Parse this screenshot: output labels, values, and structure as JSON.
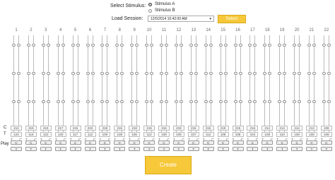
{
  "select_stimulus_label": "Select Stimulus:",
  "stimulus_options": [
    {
      "label": "Stimulus A",
      "selected": true
    },
    {
      "label": "Stimulus B",
      "selected": false
    }
  ],
  "load_session_label": "Load Session:",
  "session_value": "12/5/2014 10:42:00 AM",
  "select_button": "Select",
  "row_labels": {
    "c": "C",
    "t": "T",
    "play": "Play"
  },
  "track_letters": {
    "t": "T",
    "c": "C"
  },
  "play_letters": {
    "c": "C",
    "t": "T"
  },
  "columns": [
    {
      "num": "1",
      "c": "212",
      "t": "124"
    },
    {
      "num": "2",
      "c": "215",
      "t": "116"
    },
    {
      "num": "3",
      "c": "215",
      "t": "122"
    },
    {
      "num": "4",
      "c": "217",
      "t": "120"
    },
    {
      "num": "5",
      "c": "215",
      "t": "117"
    },
    {
      "num": "6",
      "c": "223",
      "t": "112"
    },
    {
      "num": "7",
      "c": "218",
      "t": "109"
    },
    {
      "num": "8",
      "c": "215",
      "t": "108"
    },
    {
      "num": "9",
      "c": "218",
      "t": "106"
    },
    {
      "num": "10",
      "c": "215",
      "t": "112"
    },
    {
      "num": "11",
      "c": "216",
      "t": "108"
    },
    {
      "num": "12",
      "c": "218",
      "t": "109"
    },
    {
      "num": "13",
      "c": "216",
      "t": "107"
    },
    {
      "num": "14",
      "c": "215",
      "t": "112"
    },
    {
      "num": "15",
      "c": "219",
      "t": "108"
    },
    {
      "num": "16",
      "c": "215",
      "t": "108"
    },
    {
      "num": "17",
      "c": "216",
      "t": "104"
    },
    {
      "num": "18",
      "c": "214",
      "t": "108"
    },
    {
      "num": "19",
      "c": "214",
      "t": "110"
    },
    {
      "num": "20",
      "c": "214",
      "t": "109"
    },
    {
      "num": "21",
      "c": "213",
      "t": "108"
    },
    {
      "num": "22",
      "c": "108",
      "t": "108"
    }
  ],
  "create_button": "Create"
}
